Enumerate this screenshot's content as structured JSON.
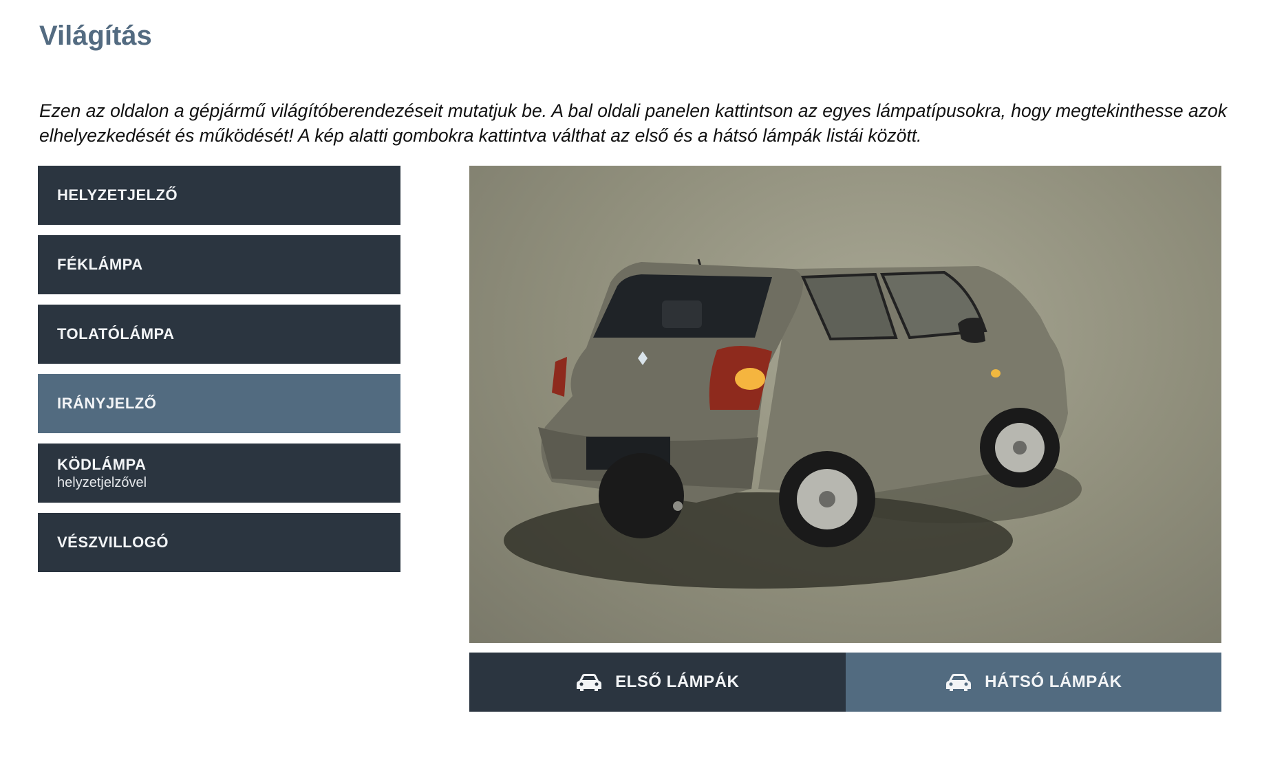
{
  "page": {
    "title": "Világítás",
    "intro": "Ezen az oldalon a gépjármű világítóberendezéseit mutatjuk be. A bal oldali panelen kattintson az egyes lámpatípusokra, hogy megtekinthesse azok elhelyezkedését és működését! A kép alatti gombokra kattintva válthat az első és a hátsó lámpák listái között."
  },
  "lamps": [
    {
      "label": "HELYZETJELZŐ",
      "sub": ""
    },
    {
      "label": "FÉKLÁMPA",
      "sub": ""
    },
    {
      "label": "TOLATÓLÁMPA",
      "sub": ""
    },
    {
      "label": "IRÁNYJELZŐ",
      "sub": "",
      "active": true
    },
    {
      "label": "KÖDLÁMPA",
      "sub": "helyzetjelzővel"
    },
    {
      "label": "VÉSZVILLOGÓ",
      "sub": ""
    }
  ],
  "view_buttons": {
    "front": {
      "label": "ELSŐ LÁMPÁK",
      "icon": "car-icon"
    },
    "rear": {
      "label": "HÁTSÓ LÁMPÁK",
      "icon": "car-icon",
      "active": true
    }
  },
  "colors": {
    "dark": "#2b3540",
    "active": "#526b80",
    "title": "#536b81"
  }
}
